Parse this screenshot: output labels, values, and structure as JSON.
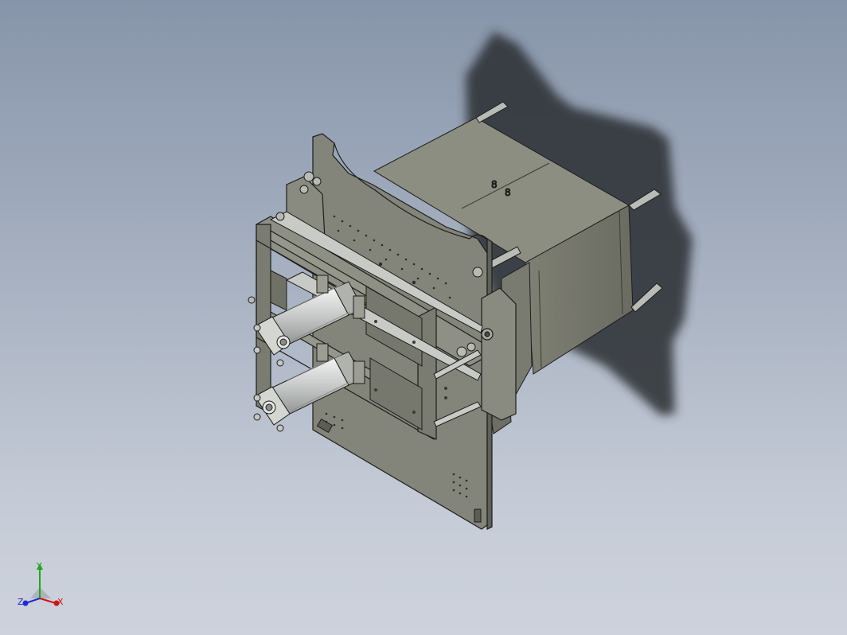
{
  "viewport": {
    "background_top": "#8795aa",
    "background_bottom": "#cdd2dc"
  },
  "model": {
    "body_color": "#86877a",
    "edge_color": "#1d1d1b",
    "shadow_color": "#2c2f33",
    "cylinder_color": "#c9cccb",
    "icon": "cad-assembly-icon"
  },
  "triad": {
    "x_label": "X",
    "y_label": "Y",
    "z_label": "Z",
    "x_color": "#d21414",
    "y_color": "#1fa81f",
    "z_color": "#1e2fd0",
    "icon": "axis-triad-icon"
  }
}
